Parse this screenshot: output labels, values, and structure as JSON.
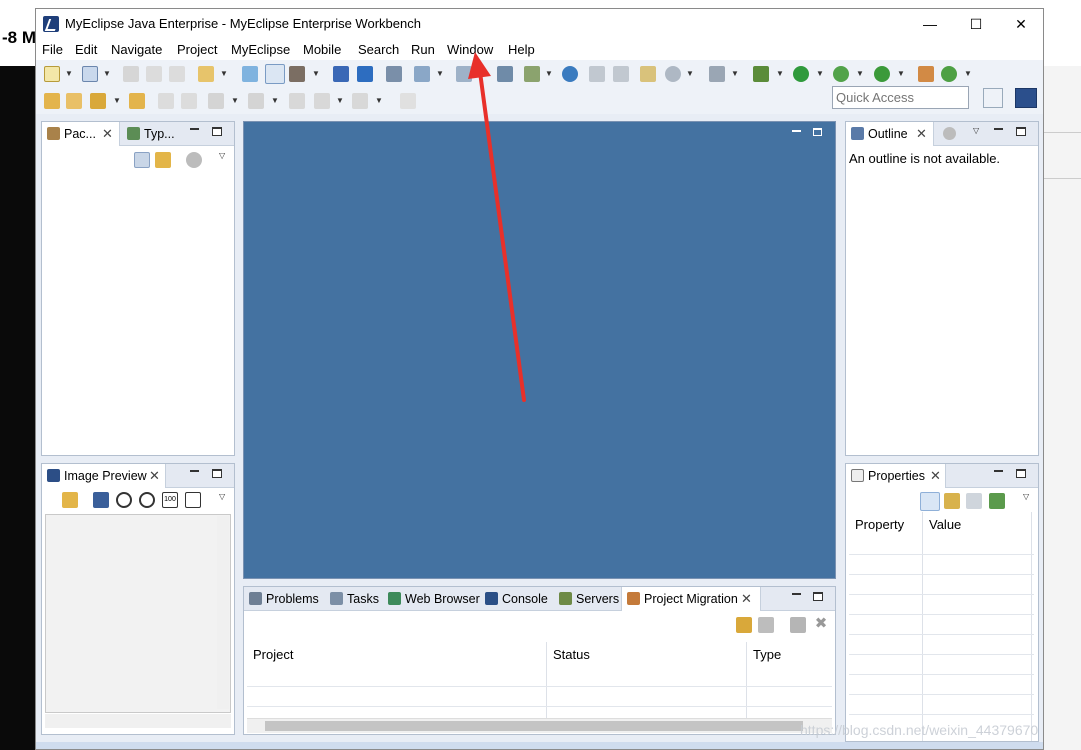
{
  "background": {
    "left_text": "-8 M"
  },
  "window": {
    "title": "MyEclipse Java Enterprise - MyEclipse Enterprise Workbench",
    "controls": {
      "minimize": "—",
      "maximize": "☐",
      "close": "✕"
    }
  },
  "menu": [
    "File",
    "Edit",
    "Navigate",
    "Project",
    "MyEclipse",
    "Mobile",
    "Search",
    "Run",
    "Window",
    "Help"
  ],
  "quick_access": {
    "placeholder": "Quick Access"
  },
  "package_panel": {
    "tabs": [
      "Pac...",
      "Typ..."
    ]
  },
  "image_preview": {
    "tab": "Image Preview"
  },
  "outline": {
    "tab": "Outline",
    "message": "An outline is not available."
  },
  "properties": {
    "tab": "Properties",
    "columns": [
      "Property",
      "Value"
    ]
  },
  "bottom_panel": {
    "tabs": [
      "Problems",
      "Tasks",
      "Web Browser",
      "Console",
      "Servers",
      "Project Migration"
    ],
    "columns": [
      "Project",
      "Status",
      "Type"
    ]
  },
  "watermark": "https://blog.csdn.net/weixin_44379670",
  "colors": {
    "editor": "#4472a1",
    "arrow": "#e8302a",
    "title_icon": "#1f3f7a"
  }
}
